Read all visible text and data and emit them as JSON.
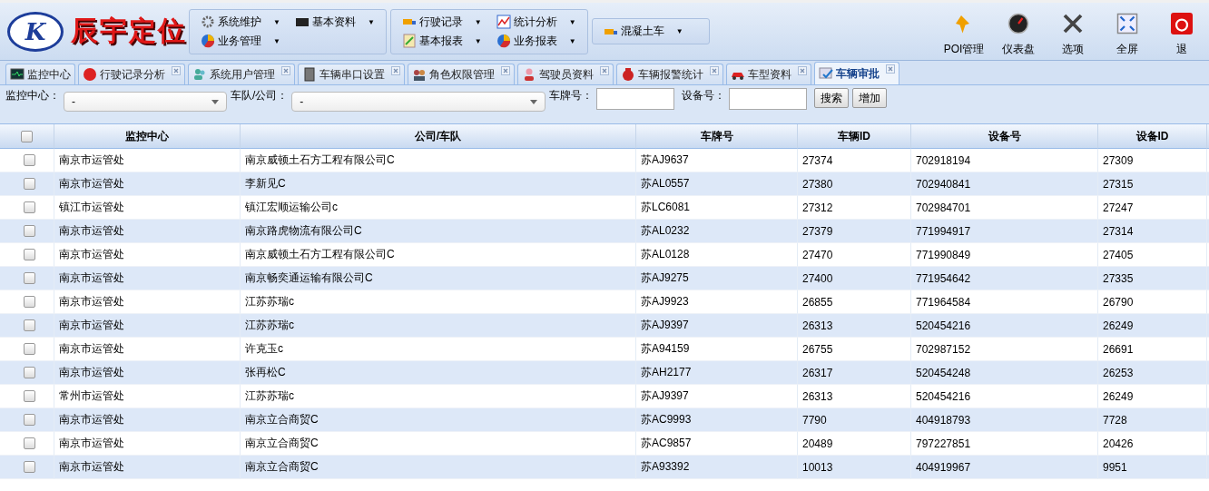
{
  "logo": {
    "mark": "K",
    "name": "辰宇定位"
  },
  "menu_groups": [
    {
      "items": [
        {
          "label": "系统维护",
          "caret": "▼"
        },
        {
          "label": "基本资料",
          "caret": "▼"
        },
        {
          "label": "业务管理",
          "caret": "▼"
        }
      ]
    },
    {
      "items": [
        {
          "label": "行驶记录",
          "caret": "▼"
        },
        {
          "label": "统计分析",
          "caret": "▼"
        },
        {
          "label": "基本报表",
          "caret": "▼"
        },
        {
          "label": "业务报表",
          "caret": "▼"
        }
      ]
    },
    {
      "items": [
        {
          "label": "混凝土车",
          "caret": "▼"
        }
      ]
    }
  ],
  "tools": [
    "POI管理",
    "仪表盘",
    "选项",
    "全屏",
    "退"
  ],
  "tabs": [
    {
      "label": "监控中心",
      "selected": false,
      "closable": false
    },
    {
      "label": "行驶记录分析",
      "selected": false,
      "closable": true
    },
    {
      "label": "系统用户管理",
      "selected": false,
      "closable": true
    },
    {
      "label": "车辆串口设置",
      "selected": false,
      "closable": true
    },
    {
      "label": "角色权限管理",
      "selected": false,
      "closable": true
    },
    {
      "label": "驾驶员资料",
      "selected": false,
      "closable": true
    },
    {
      "label": "车辆报警统计",
      "selected": false,
      "closable": true
    },
    {
      "label": "车型资料",
      "selected": false,
      "closable": true
    },
    {
      "label": "车辆审批",
      "selected": true,
      "closable": true
    }
  ],
  "filters": [
    {
      "kind": "select",
      "label": "监控中心：",
      "value": "-"
    },
    {
      "kind": "select",
      "label": "车队/公司：",
      "value": "-"
    },
    {
      "kind": "input",
      "label": "车牌号："
    },
    {
      "kind": "input",
      "label": "设备号："
    }
  ],
  "buttons": [
    "搜索",
    "增加"
  ],
  "table": {
    "select_all": false,
    "columns": [
      "监控中心",
      "公司/车队",
      "车牌号",
      "车辆ID",
      "设备号",
      "设备ID"
    ],
    "rows": [
      {
        "checked": false,
        "cells": [
          "南京市运管处",
          "南京威顿土石方工程有限公司C",
          "苏AJ9637",
          "27374",
          "702918194",
          "27309"
        ]
      },
      {
        "checked": false,
        "cells": [
          "南京市运管处",
          "李新见C",
          "苏AL0557",
          "27380",
          "702940841",
          "27315"
        ]
      },
      {
        "checked": false,
        "cells": [
          "镇江市运管处",
          "镇江宏顺运输公司c",
          "苏LC6081",
          "27312",
          "702984701",
          "27247"
        ]
      },
      {
        "checked": false,
        "cells": [
          "南京市运管处",
          "南京路虎物流有限公司C",
          "苏AL0232",
          "27379",
          "771994917",
          "27314"
        ]
      },
      {
        "checked": false,
        "cells": [
          "南京市运管处",
          "南京威顿土石方工程有限公司C",
          "苏AL0128",
          "27470",
          "771990849",
          "27405"
        ]
      },
      {
        "checked": false,
        "cells": [
          "南京市运管处",
          "南京畅奕通运输有限公司C",
          "苏AJ9275",
          "27400",
          "771954642",
          "27335"
        ]
      },
      {
        "checked": false,
        "cells": [
          "南京市运管处",
          "江苏苏瑞c",
          "苏AJ9923",
          "26855",
          "771964584",
          "26790"
        ]
      },
      {
        "checked": false,
        "cells": [
          "南京市运管处",
          "江苏苏瑞c",
          "苏AJ9397",
          "26313",
          "520454216",
          "26249"
        ]
      },
      {
        "checked": false,
        "cells": [
          "南京市运管处",
          "许克玉c",
          "苏A94159",
          "26755",
          "702987152",
          "26691"
        ]
      },
      {
        "checked": false,
        "cells": [
          "南京市运管处",
          "张再松C",
          "苏AH2177",
          "26317",
          "520454248",
          "26253"
        ]
      },
      {
        "checked": false,
        "cells": [
          "常州市运管处",
          "江苏苏瑞c",
          "苏AJ9397",
          "26313",
          "520454216",
          "26249"
        ]
      },
      {
        "checked": false,
        "cells": [
          "南京市运管处",
          "南京立合商贸C",
          "苏AC9993",
          "7790",
          "404918793",
          "7728"
        ]
      },
      {
        "checked": false,
        "cells": [
          "南京市运管处",
          "南京立合商贸C",
          "苏AC9857",
          "20489",
          "797227851",
          "20426"
        ]
      },
      {
        "checked": false,
        "cells": [
          "南京市运管处",
          "南京立合商贸C",
          "苏A93392",
          "10013",
          "404919967",
          "9951"
        ]
      }
    ]
  }
}
